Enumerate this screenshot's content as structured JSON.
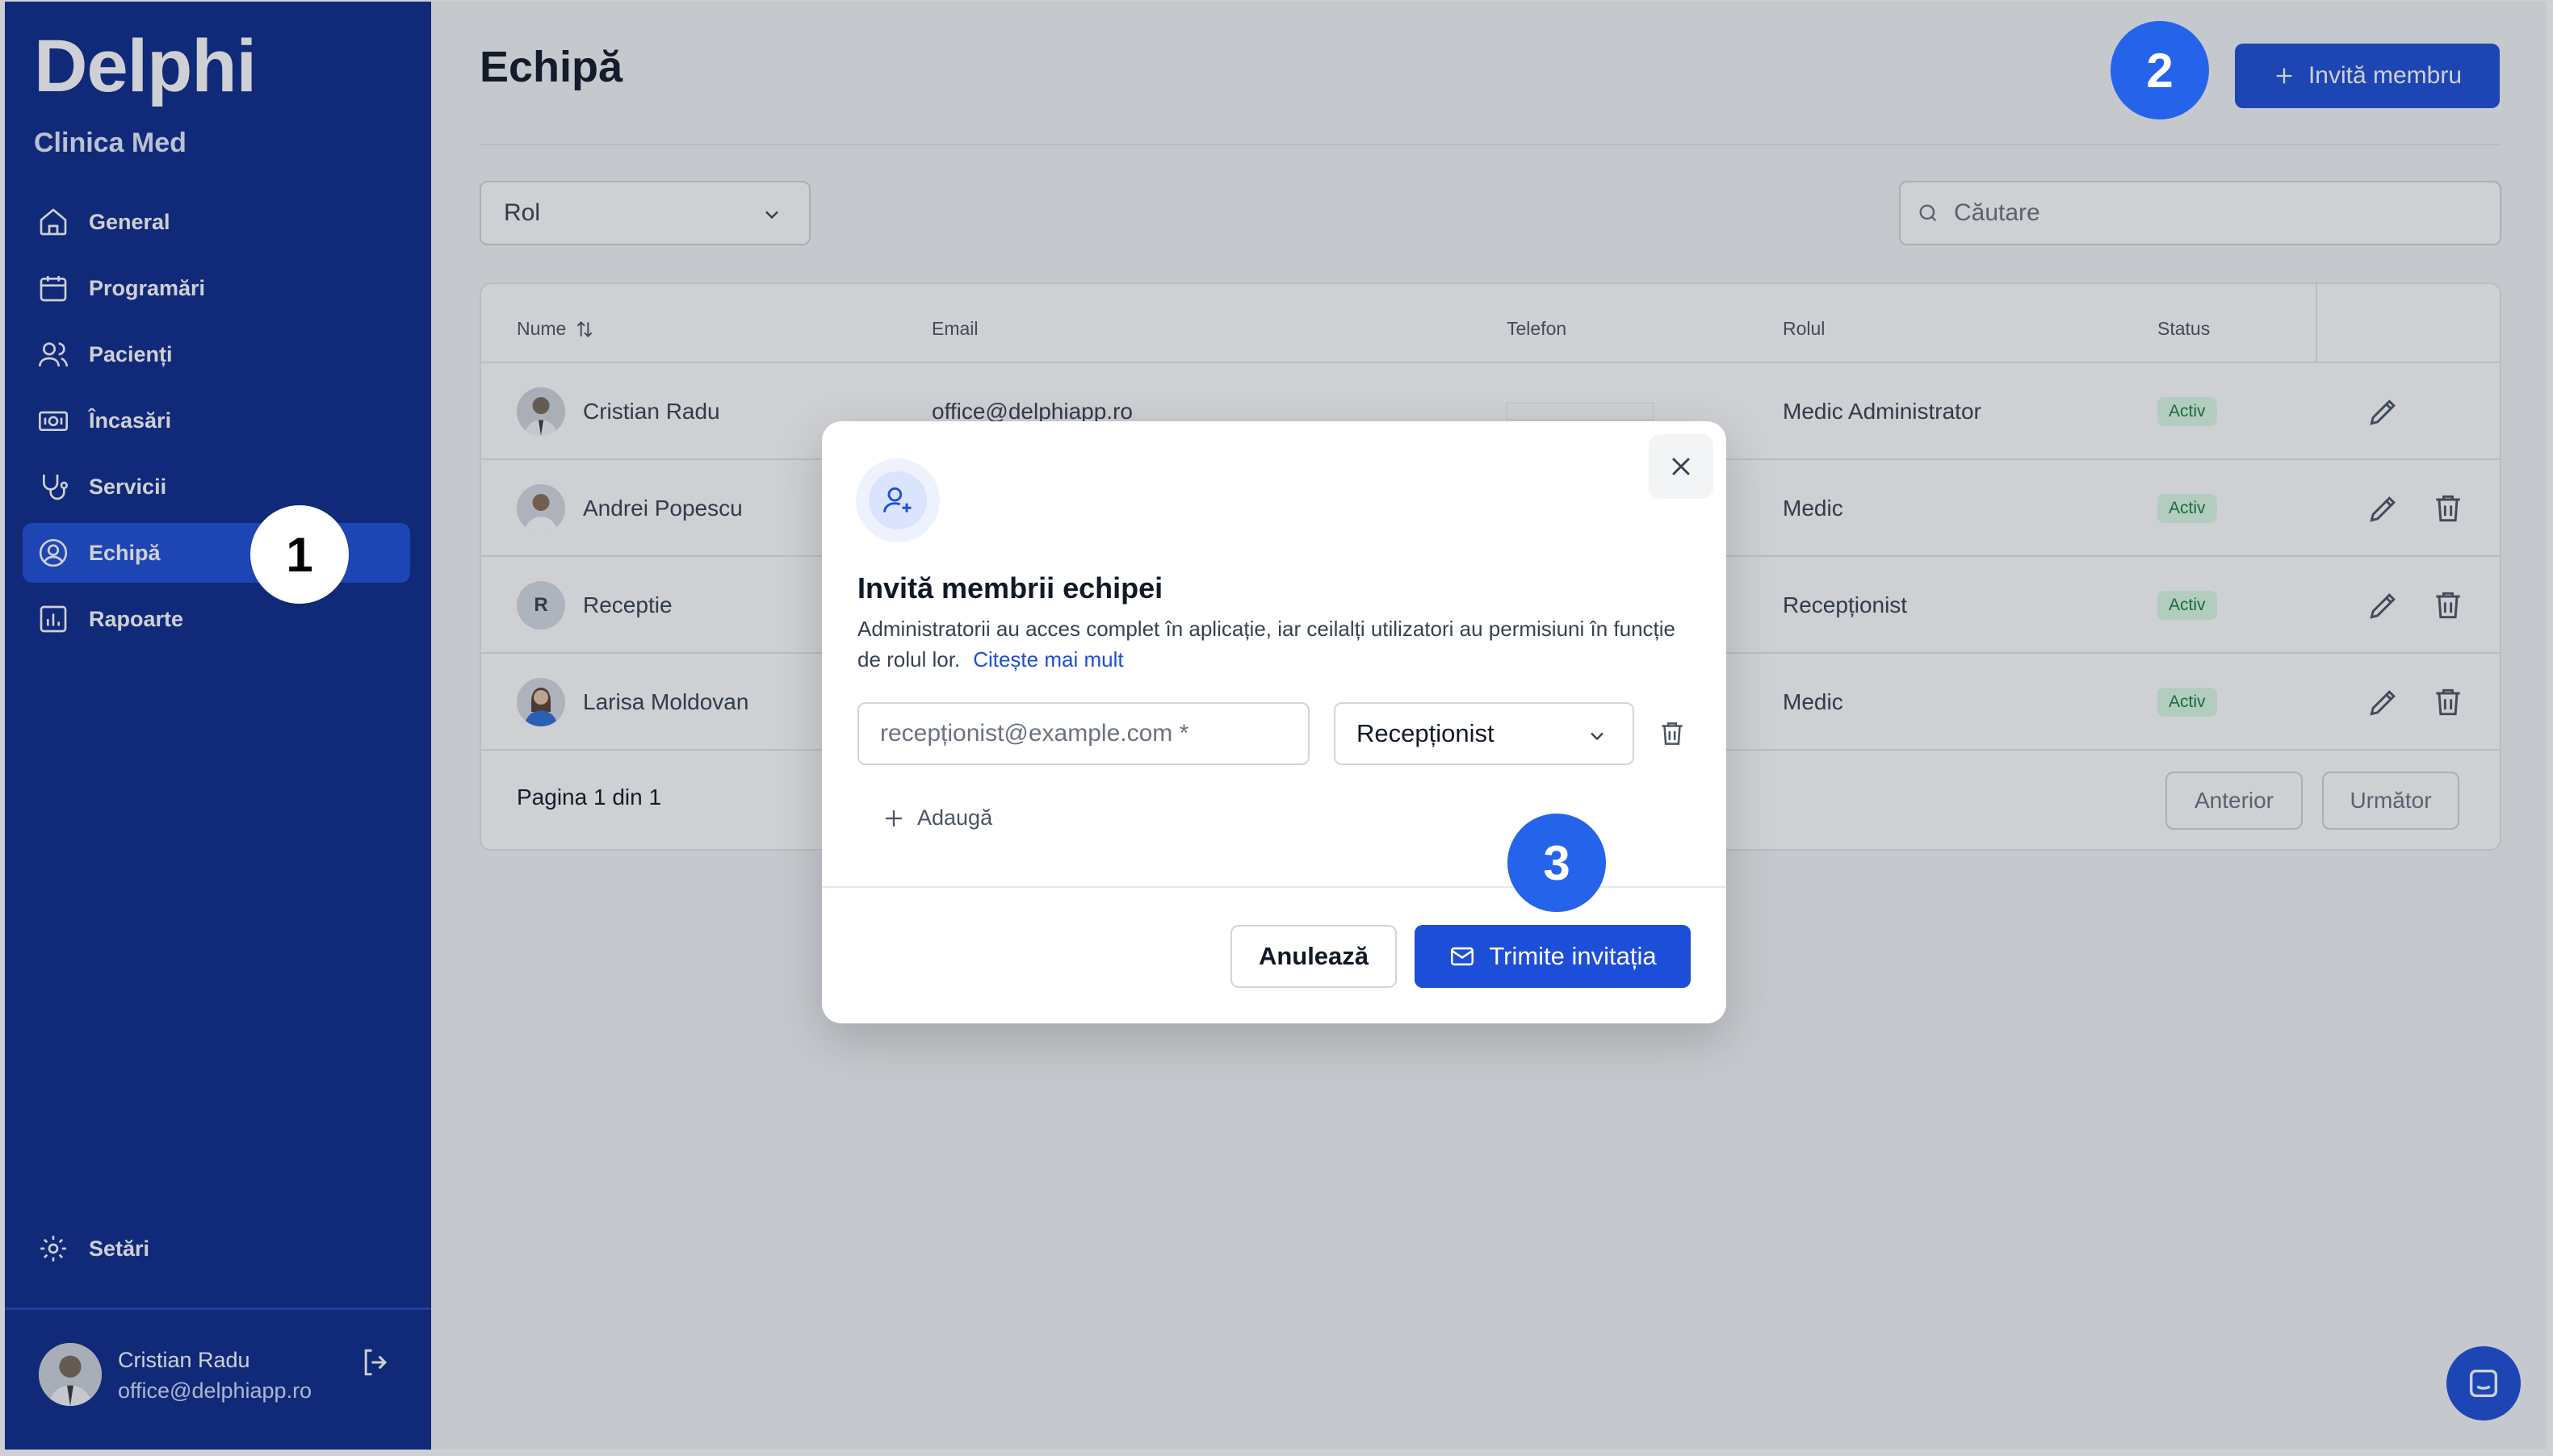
{
  "sidebar": {
    "brand": "Delphi",
    "clinic": "Clinica Med",
    "items": [
      {
        "label": "General",
        "icon": "home-icon"
      },
      {
        "label": "Programări",
        "icon": "calendar-icon"
      },
      {
        "label": "Pacienți",
        "icon": "users-icon"
      },
      {
        "label": "Încasări",
        "icon": "cash-icon"
      },
      {
        "label": "Servicii",
        "icon": "stethoscope-icon"
      },
      {
        "label": "Echipă",
        "icon": "user-circle-icon",
        "active": true
      },
      {
        "label": "Rapoarte",
        "icon": "chart-icon"
      }
    ],
    "settings": "Setări",
    "user": {
      "name": "Cristian Radu",
      "email": "office@delphiapp.ro"
    }
  },
  "header": {
    "title": "Echipă",
    "invite_button": "Invită membru"
  },
  "filters": {
    "role_placeholder": "Rol",
    "search_placeholder": "Căutare"
  },
  "table": {
    "columns": {
      "name": "Nume",
      "email": "Email",
      "phone": "Telefon",
      "role": "Rolul",
      "status": "Status"
    },
    "rows": [
      {
        "name": "Cristian Radu",
        "email": "office@delphiapp.ro",
        "role": "Medic Administrator",
        "status": "Activ"
      },
      {
        "name": "Andrei Popescu",
        "email": "",
        "role": "Medic",
        "status": "Activ"
      },
      {
        "name": "Receptie",
        "initial": "R",
        "email": "",
        "role": "Recepționist",
        "status": "Activ"
      },
      {
        "name": "Larisa Moldovan",
        "email": "",
        "role": "Medic",
        "status": "Activ"
      }
    ],
    "pagination": "Pagina 1 din 1",
    "prev": "Anterior",
    "next": "Următor"
  },
  "modal": {
    "title": "Invită membrii echipei",
    "description": "Administratorii au acces complet în aplicație, iar ceilalți utilizatori au permisiuni în funcție de rolul lor.",
    "read_more": "Citește mai mult",
    "email_placeholder": "recepționist@example.com *",
    "role_value": "Recepționist",
    "add_label": "Adaugă",
    "cancel": "Anulează",
    "send": "Trimite invitația"
  },
  "markers": [
    "1",
    "2",
    "3"
  ],
  "colors": {
    "sidebar": "#0c2a8c",
    "accent": "#1d4ed8",
    "marker": "#2563eb",
    "badge_bg": "#dcfce7",
    "badge_text": "#15803d"
  }
}
